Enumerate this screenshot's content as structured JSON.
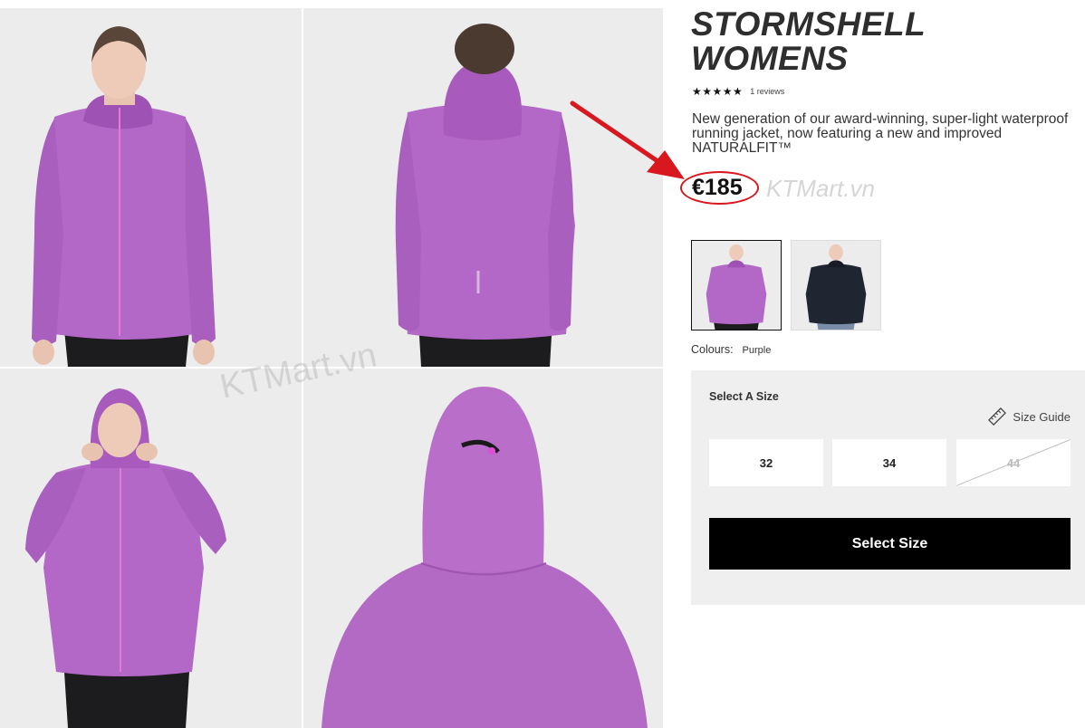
{
  "product": {
    "title_line1": "STORMSHELL",
    "title_line2": "WOMENS",
    "stars": "★★★★★",
    "reviews": "1 reviews",
    "description": "New generation of our award-winning, super-light waterproof running jacket, now featuring a new and improved NATURALFIT™",
    "price": "€185"
  },
  "watermark": "KTMart.vn",
  "colours": {
    "label": "Colours:",
    "selected": "Purple",
    "swatches": [
      "purple",
      "black"
    ]
  },
  "size_selector": {
    "heading": "Select A Size",
    "guide_label": "Size Guide",
    "sizes": [
      {
        "label": "32",
        "available": true
      },
      {
        "label": "34",
        "available": true
      },
      {
        "label": "44",
        "available": false
      }
    ],
    "button_label": "Select Size"
  },
  "gallery": {
    "views": [
      "front",
      "back",
      "hood-up-front",
      "hood-back-closeup"
    ]
  },
  "colors": {
    "jacket_purple": "#b368c7",
    "jacket_navy": "#1f2632",
    "annotation_red": "#d9171f",
    "button_black": "#000000",
    "panel_bg": "#efefef"
  },
  "icons": [
    "ruler-icon",
    "annotation-arrow-icon"
  ]
}
